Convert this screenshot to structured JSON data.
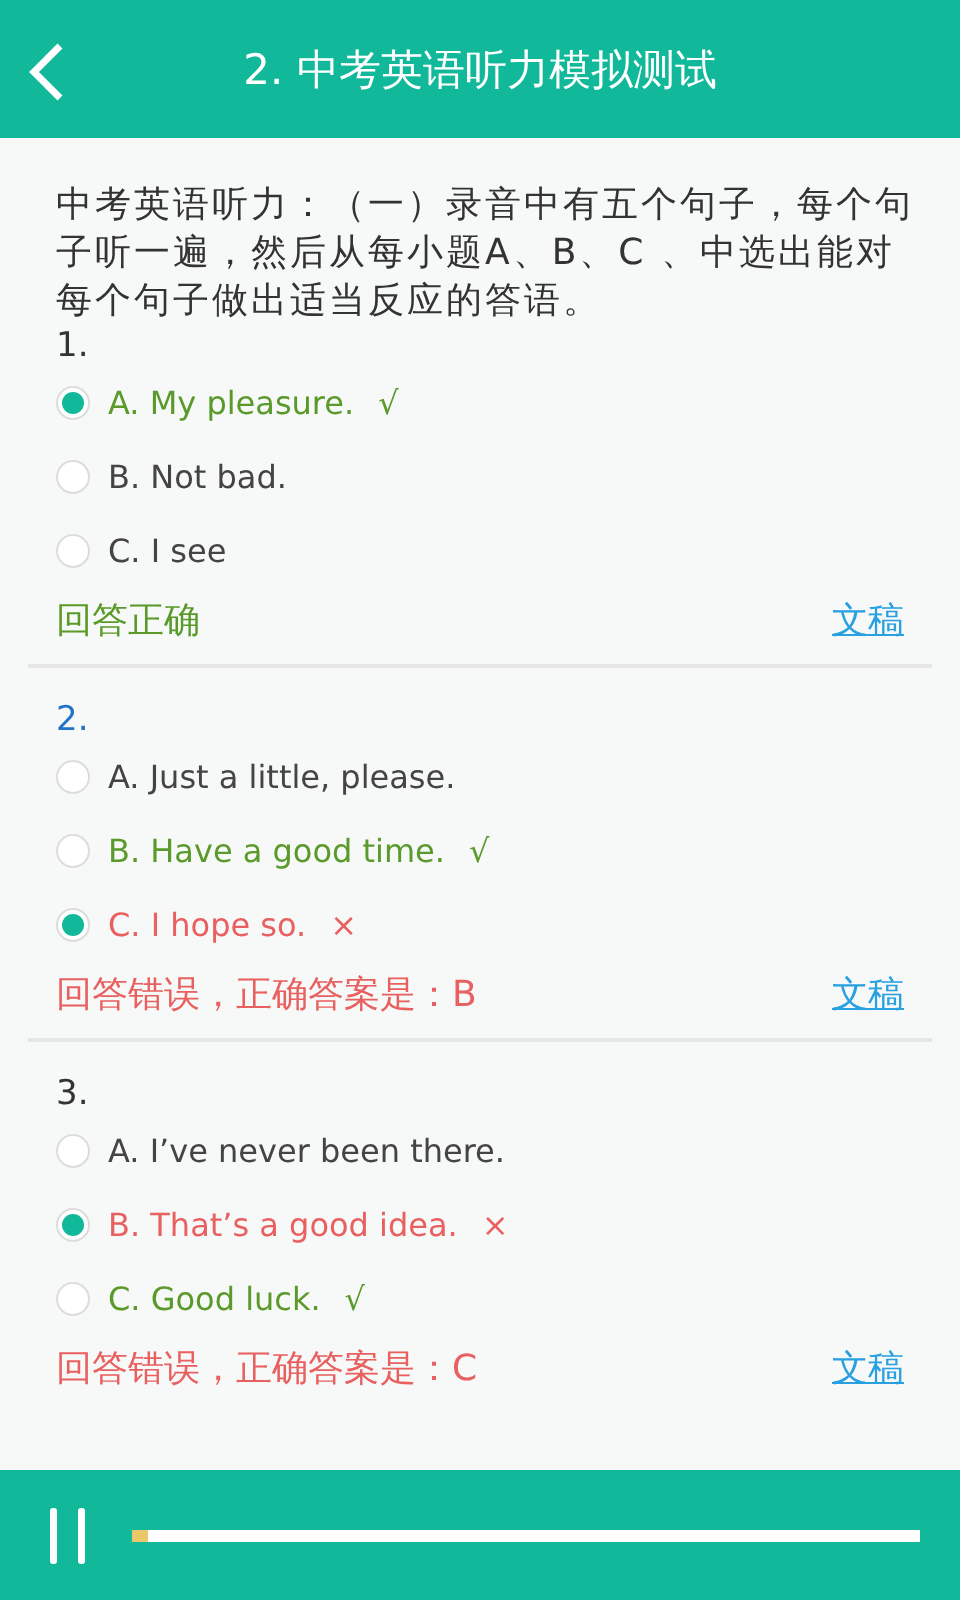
{
  "header": {
    "title": "2. 中考英语听力模拟测试"
  },
  "intro": "中考英语听力：（一）录音中有五个句子，每个句子听一遍，然后从每小题A、B、C 、中选出能对每个句子做出适当反应的答语。",
  "questions": [
    {
      "number": "1.",
      "current": false,
      "options": [
        {
          "text": "A. My pleasure.",
          "mark": "√",
          "kind": "correct",
          "selected": true
        },
        {
          "text": "B. Not bad.",
          "kind": "plain",
          "selected": false
        },
        {
          "text": "C. I see",
          "kind": "plain",
          "selected": false
        }
      ],
      "result": {
        "text": "回答正确",
        "correct": true
      },
      "link": "文稿"
    },
    {
      "number": "2.",
      "current": true,
      "options": [
        {
          "text": "A. Just a little, please.",
          "kind": "plain",
          "selected": false
        },
        {
          "text": "B. Have a good time.",
          "mark": "√",
          "kind": "correct",
          "selected": false
        },
        {
          "text": "C. I hope so.",
          "mark": "×",
          "kind": "wrong",
          "selected": true
        }
      ],
      "result": {
        "text": "回答错误，正确答案是：B",
        "correct": false
      },
      "link": "文稿"
    },
    {
      "number": "3.",
      "current": false,
      "options": [
        {
          "text": "A. I’ve never been there.",
          "kind": "plain",
          "selected": false
        },
        {
          "text": "B. That’s a good idea.",
          "mark": "×",
          "kind": "wrong",
          "selected": true
        },
        {
          "text": "C. Good luck.",
          "mark": "√",
          "kind": "correct",
          "selected": false
        }
      ],
      "result": {
        "text": "回答错误，正确答案是：C",
        "correct": false
      },
      "link": "文稿"
    }
  ],
  "player": {
    "playing": true,
    "level": 0.02
  }
}
